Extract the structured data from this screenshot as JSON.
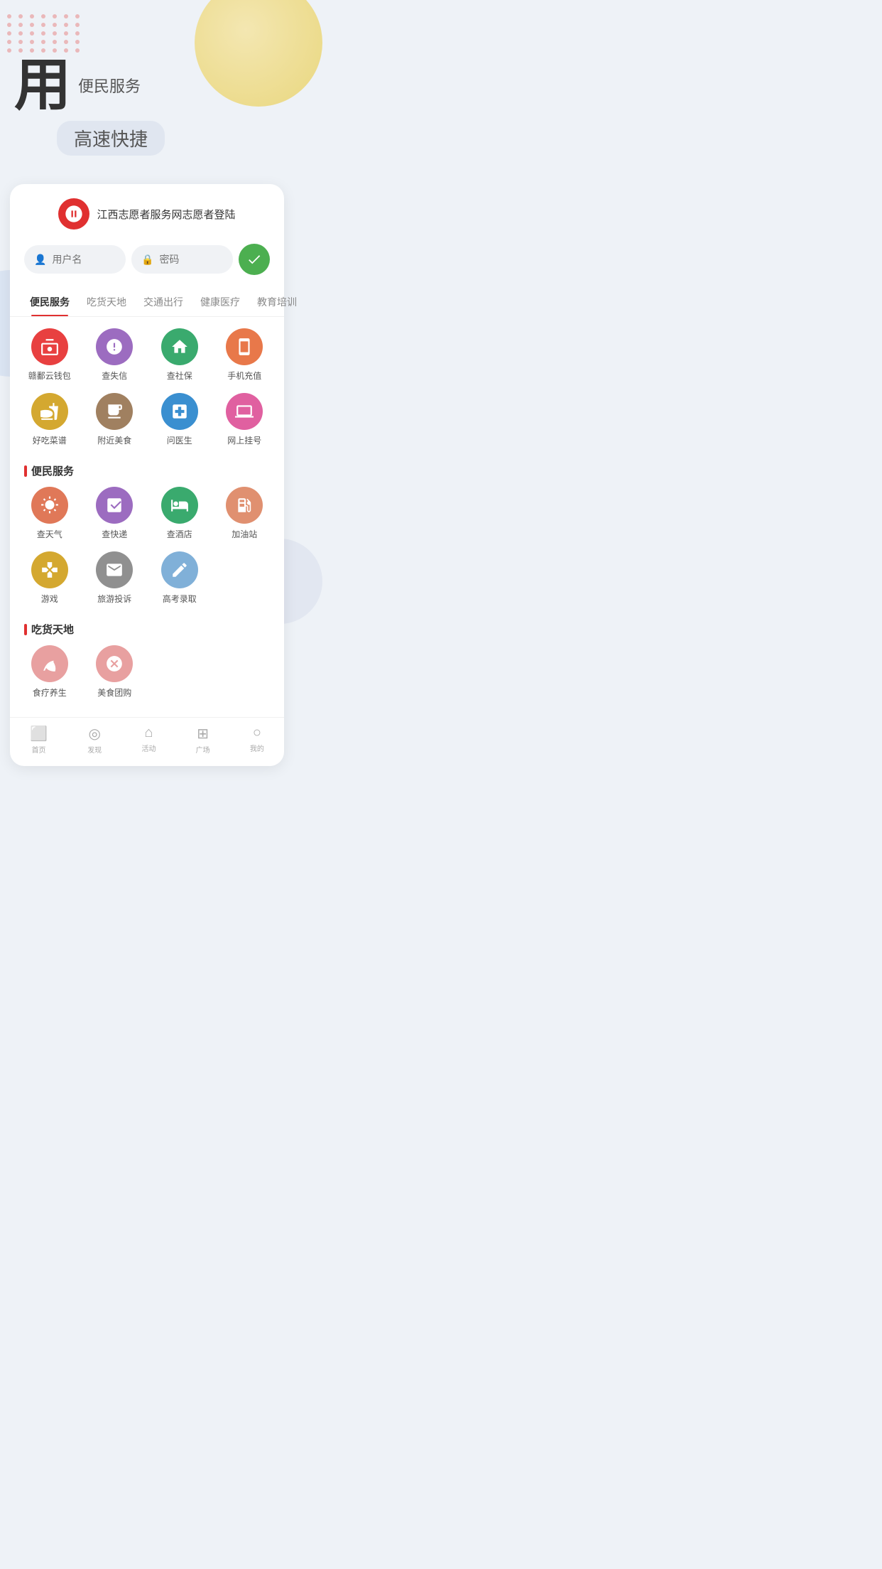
{
  "hero": {
    "main_char": "用",
    "subtitle_inline": "便民服务",
    "subtitle_block": "高速快捷"
  },
  "login": {
    "logo_alt": "江西志愿者logo",
    "title": "江西志愿者服务网志愿者登陆",
    "username_placeholder": "用户名",
    "password_placeholder": "密码"
  },
  "tabs": [
    {
      "label": "便民服务",
      "active": true
    },
    {
      "label": "吃货天地",
      "active": false
    },
    {
      "label": "交通出行",
      "active": false
    },
    {
      "label": "健康医疗",
      "active": false
    },
    {
      "label": "教育培训",
      "active": false
    }
  ],
  "quick_services": [
    {
      "label": "赣鄱云钱包",
      "color": "c-red",
      "icon": "wallet"
    },
    {
      "label": "查失信",
      "color": "c-purple",
      "icon": "alert"
    },
    {
      "label": "查社保",
      "color": "c-green",
      "icon": "home"
    },
    {
      "label": "手机充值",
      "color": "c-orange",
      "icon": "phone"
    },
    {
      "label": "好吃菜谱",
      "color": "c-yellow",
      "icon": "food"
    },
    {
      "label": "附近美食",
      "color": "c-brown",
      "icon": "drink"
    },
    {
      "label": "问医生",
      "color": "c-blue",
      "icon": "medical"
    },
    {
      "label": "网上挂号",
      "color": "c-pink",
      "icon": "computer"
    }
  ],
  "section1": {
    "title": "便民服务"
  },
  "services1": [
    {
      "label": "查天气",
      "color": "c-salmon",
      "icon": "cloud"
    },
    {
      "label": "查快递",
      "color": "c-purple",
      "icon": "box"
    },
    {
      "label": "查酒店",
      "color": "c-green",
      "icon": "hotel"
    },
    {
      "label": "加油站",
      "color": "c-peach",
      "icon": "fuel"
    },
    {
      "label": "游戏",
      "color": "c-yellow",
      "icon": "game"
    },
    {
      "label": "旅游投诉",
      "color": "c-gray",
      "icon": "mail"
    },
    {
      "label": "高考录取",
      "color": "c-ltblue",
      "icon": "pen"
    }
  ],
  "section2": {
    "title": "吃货天地"
  },
  "services2": [
    {
      "label": "食疗养生",
      "color": "c-ltred",
      "icon": "leaf"
    },
    {
      "label": "美食团购",
      "color": "c-ltred",
      "icon": "x-circle"
    }
  ],
  "bottom_nav": [
    {
      "label": "首页",
      "icon": "home"
    },
    {
      "label": "发现",
      "icon": "compass"
    },
    {
      "label": "活动",
      "icon": "house"
    },
    {
      "label": "广场",
      "icon": "grid"
    },
    {
      "label": "我的",
      "icon": "person"
    }
  ]
}
